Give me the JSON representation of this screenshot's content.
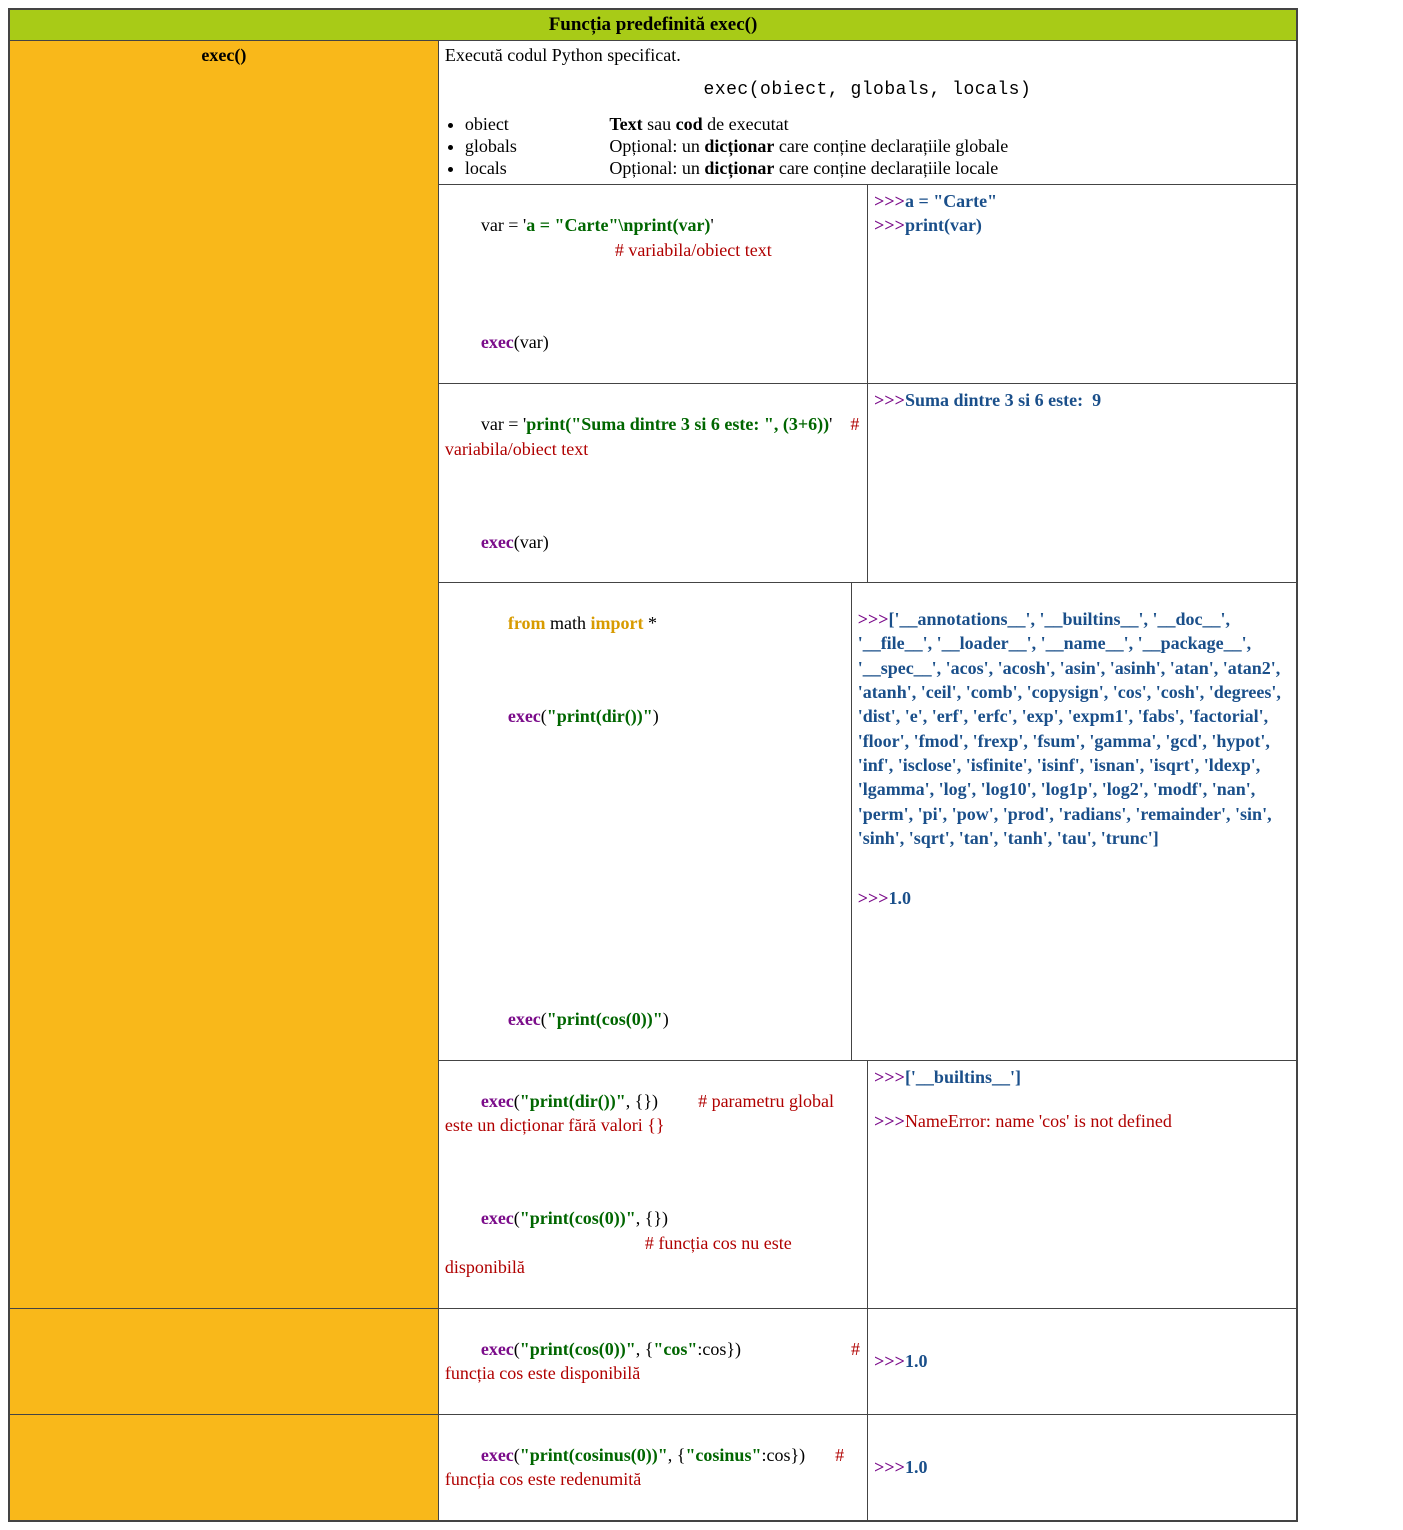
{
  "title": "Funcția predefinită exec()",
  "fnLabel": "exec()",
  "desc": {
    "lead": "Execută codul Python specificat.",
    "sig": "exec(obiect, globals, locals)",
    "params": [
      {
        "name": "obiect",
        "pre": "",
        "b1": "Text",
        "mid": " sau ",
        "b2": "cod",
        "post": " de executat"
      },
      {
        "name": "globals",
        "pre": "Opțional: un ",
        "b1": "dicționar",
        "mid": "",
        "b2": "",
        "post": " care conține declarațiile globale"
      },
      {
        "name": "locals",
        "pre": "Opțional: un ",
        "b1": "dicționar",
        "mid": "",
        "b2": "",
        "post": " care conține declarațiile locale"
      }
    ]
  },
  "r1": {
    "l1a": "var = '",
    "l1s": "a = \"Carte\"\\nprint(var)",
    "l1b": "'",
    "c1": "# variabila/obiect text",
    "l2a": "exec",
    "l2b": "(var)",
    "o1": "a = \"Carte\"",
    "o2": "print(var)"
  },
  "r2": {
    "l1a": "var = '",
    "l1s": "print(\"Suma dintre 3 si 6 este: \", (3+6))",
    "l1b": "'",
    "c1": "# variabila/obiect text",
    "l2a": "exec",
    "l2b": "(var)",
    "o1": "Suma dintre 3 si 6 este:  9"
  },
  "r3": {
    "l1a": "from",
    "l1b": " math ",
    "l1c": "import",
    "l1d": " *",
    "l2a": "exec",
    "l2b": "(",
    "l2s": "\"print(dir())\"",
    "l2c": ")",
    "l3a": "exec",
    "l3b": "(",
    "l3s": "\"print(cos(0))\"",
    "l3c": ")",
    "o1": "['__annotations__', '__builtins__', '__doc__', '__file__', '__loader__', '__name__', '__package__', '__spec__', 'acos', 'acosh', 'asin', 'asinh', 'atan', 'atan2', 'atanh', 'ceil', 'comb', 'copysign', 'cos', 'cosh', 'degrees', 'dist', 'e', 'erf', 'erfc', 'exp', 'expm1', 'fabs', 'factorial', 'floor', 'fmod', 'frexp', 'fsum', 'gamma', 'gcd', 'hypot', 'inf', 'isclose', 'isfinite', 'isinf', 'isnan', 'isqrt', 'ldexp', 'lgamma', 'log', 'log10', 'log1p', 'log2', 'modf', 'nan', 'perm', 'pi', 'pow', 'prod', 'radians', 'remainder', 'sin', 'sinh', 'sqrt', 'tan', 'tanh', 'tau', 'trunc']",
    "o2": "1.0"
  },
  "r4": {
    "l1a": "exec",
    "l1b": "(",
    "l1s": "\"print(dir())\"",
    "l1c": ", {})",
    "c1": "# parametru global este un dicționar fără valori {}",
    "l2a": "exec",
    "l2b": "(",
    "l2s": "\"print(cos(0))\"",
    "l2c": ", {})",
    "c2": "# funcția cos nu este disponibilă",
    "o1": "['__builtins__']",
    "o2": "NameError: name 'cos' is not defined"
  },
  "r5": {
    "l1a": "exec",
    "l1b": "(",
    "l1s": "\"print(cos(0))\"",
    "l1c": ", {",
    "l1k": "\"cos\"",
    "l1d": ":cos})",
    "c1": "# funcția cos este disponibilă",
    "o1": "1.0"
  },
  "r6": {
    "l1a": "exec",
    "l1b": "(",
    "l1s": "\"print(cosinus(0))\"",
    "l1c": ", {",
    "l1k": "\"cosinus\"",
    "l1d": ":cos})",
    "c1": "# funcția cos este redenumită",
    "o1": "1.0"
  },
  "prompt": ">>>"
}
